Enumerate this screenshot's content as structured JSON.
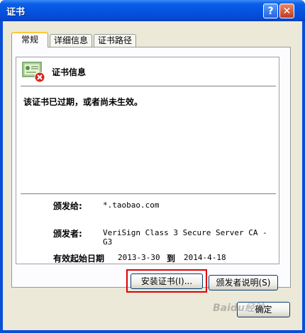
{
  "window": {
    "title": "证书"
  },
  "titlebar_buttons": {
    "help": "?",
    "close": "✕"
  },
  "tabs": [
    {
      "label": "常规",
      "active": true
    },
    {
      "label": "详细信息",
      "active": false
    },
    {
      "label": "证书路径",
      "active": false
    }
  ],
  "info": {
    "title": "证书信息",
    "status": "该证书已过期，或者尚未生效。",
    "issued_to_label": "颁发给:",
    "issued_to_value": "*.taobao.com",
    "issued_by_label": "颁发者:",
    "issued_by_value": "VeriSign Class 3 Secure Server CA - G3",
    "valid_label": "有效起始日期",
    "valid_from": "2013-3-30",
    "valid_to_label": "到",
    "valid_to": "2014-4-18"
  },
  "buttons": {
    "install": "安装证书(I)...",
    "issuer_statement": "颁发者说明(S)",
    "ok": "确定"
  },
  "watermark": "Baidu经验",
  "colors": {
    "highlight": "#e00000",
    "titlebar": "#0453df"
  }
}
